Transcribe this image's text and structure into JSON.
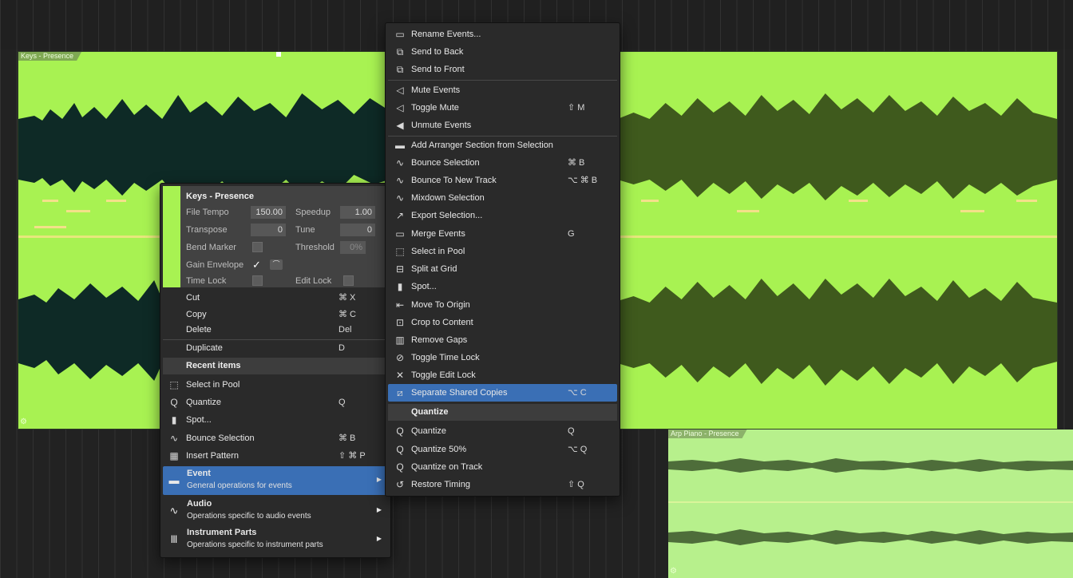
{
  "tracks": {
    "keys_clip_name": "Keys - Presence",
    "arp_clip_name": "Arp Piano - Presence"
  },
  "inspector": {
    "title": "Keys - Presence",
    "file_tempo_label": "File Tempo",
    "file_tempo_value": "150.00",
    "speedup_label": "Speedup",
    "speedup_value": "1.00",
    "transpose_label": "Transpose",
    "transpose_value": "0",
    "tune_label": "Tune",
    "tune_value": "0",
    "bend_marker_label": "Bend Marker",
    "threshold_label": "Threshold",
    "threshold_value": "0%",
    "gain_envelope_label": "Gain Envelope",
    "gain_envelope_check": "✓",
    "time_lock_label": "Time Lock",
    "edit_lock_label": "Edit Lock"
  },
  "left_menu": {
    "cut": {
      "label": "Cut",
      "shortcut": "⌘ X"
    },
    "copy": {
      "label": "Copy",
      "shortcut": "⌘ C"
    },
    "delete": {
      "label": "Delete",
      "shortcut": "Del"
    },
    "duplicate": {
      "label": "Duplicate",
      "shortcut": "D"
    },
    "recent_header": "Recent items",
    "recent": [
      {
        "label": "Select in Pool",
        "shortcut": "",
        "icon": "select-in-pool-icon"
      },
      {
        "label": "Quantize",
        "shortcut": "Q",
        "icon": "quantize-icon"
      },
      {
        "label": "Spot...",
        "shortcut": "",
        "icon": "spot-icon"
      },
      {
        "label": "Bounce Selection",
        "shortcut": "⌘ B",
        "icon": "bounce-icon"
      },
      {
        "label": "Insert Pattern",
        "shortcut": "⇧ ⌘ P",
        "icon": "pattern-icon"
      }
    ],
    "submenus": [
      {
        "title": "Event",
        "desc": "General operations for events",
        "icon": "event-icon"
      },
      {
        "title": "Audio",
        "desc": "Operations specific to audio events",
        "icon": "audio-icon"
      },
      {
        "title": "Instrument Parts",
        "desc": "Operations specific to instrument parts",
        "icon": "instrument-icon"
      }
    ]
  },
  "right_menu": {
    "items": [
      {
        "label": "Rename Events...",
        "shortcut": "",
        "icon": "rename-icon"
      },
      {
        "label": "Send to Back",
        "shortcut": "",
        "icon": "send-back-icon"
      },
      {
        "label": "Send to Front",
        "shortcut": "",
        "icon": "send-front-icon"
      },
      {
        "label": "Mute Events",
        "shortcut": "",
        "icon": "mute-icon"
      },
      {
        "label": "Toggle Mute",
        "shortcut": "⇧ M",
        "icon": "toggle-mute-icon"
      },
      {
        "label": "Unmute Events",
        "shortcut": "",
        "icon": "unmute-icon"
      },
      {
        "label": "Add Arranger Section from Selection",
        "shortcut": "",
        "icon": "arranger-icon"
      },
      {
        "label": "Bounce Selection",
        "shortcut": "⌘ B",
        "icon": "bounce-icon"
      },
      {
        "label": "Bounce To New Track",
        "shortcut": "⌥ ⌘ B",
        "icon": "bounce-new-track-icon"
      },
      {
        "label": "Mixdown Selection",
        "shortcut": "",
        "icon": "mixdown-icon"
      },
      {
        "label": "Export Selection...",
        "shortcut": "",
        "icon": "export-icon"
      },
      {
        "label": "Merge Events",
        "shortcut": "G",
        "icon": "merge-icon"
      },
      {
        "label": "Select in Pool",
        "shortcut": "",
        "icon": "select-in-pool-icon"
      },
      {
        "label": "Split at Grid",
        "shortcut": "",
        "icon": "split-grid-icon"
      },
      {
        "label": "Spot...",
        "shortcut": "",
        "icon": "spot-icon"
      },
      {
        "label": "Move To Origin",
        "shortcut": "",
        "icon": "move-origin-icon"
      },
      {
        "label": "Crop to Content",
        "shortcut": "",
        "icon": "crop-icon"
      },
      {
        "label": "Remove Gaps",
        "shortcut": "",
        "icon": "remove-gaps-icon"
      },
      {
        "label": "Toggle Time Lock",
        "shortcut": "",
        "icon": "time-lock-icon"
      },
      {
        "label": "Toggle Edit Lock",
        "shortcut": "",
        "icon": "edit-lock-icon"
      },
      {
        "label": "Separate Shared Copies",
        "shortcut": "⌥ C",
        "icon": "separate-copies-icon"
      }
    ],
    "quantize_header": "Quantize",
    "quantize_items": [
      {
        "label": "Quantize",
        "shortcut": "Q",
        "icon": "quantize-icon"
      },
      {
        "label": "Quantize 50%",
        "shortcut": "⌥ Q",
        "icon": "quantize-50-icon"
      },
      {
        "label": "Quantize on Track",
        "shortcut": "",
        "icon": "quantize-track-icon"
      },
      {
        "label": "Restore Timing",
        "shortcut": "⇧ Q",
        "icon": "restore-timing-icon"
      }
    ]
  },
  "colors": {
    "keys_clip": "#a8f252",
    "arp_clip": "#b7f08c",
    "highlight": "#3a6fb5",
    "waveform_dark": "#0e2a26"
  }
}
